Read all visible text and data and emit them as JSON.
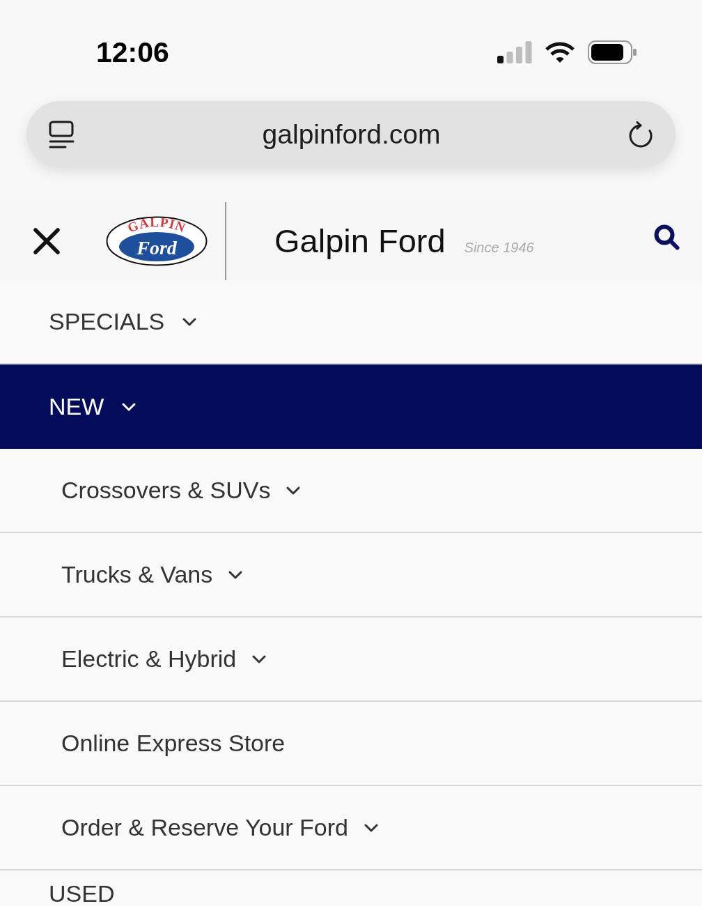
{
  "status_bar": {
    "time": "12:06"
  },
  "browser": {
    "url": "galpinford.com"
  },
  "header": {
    "logo": {
      "arc_text": "GALPIN",
      "script_text": "Ford"
    },
    "title": "Galpin Ford",
    "tagline": "Since 1946"
  },
  "menu": [
    {
      "label": "SPECIALS",
      "kind": "dropdown",
      "expanded": false
    },
    {
      "label": "NEW",
      "kind": "dropdown",
      "expanded": true,
      "children": [
        {
          "label": "Crossovers & SUVs",
          "kind": "dropdown"
        },
        {
          "label": "Trucks & Vans",
          "kind": "dropdown"
        },
        {
          "label": "Electric & Hybrid",
          "kind": "dropdown"
        },
        {
          "label": "Online Express Store",
          "kind": "link"
        },
        {
          "label": "Order & Reserve Your Ford",
          "kind": "dropdown"
        }
      ]
    },
    {
      "label": "USED",
      "kind": "link",
      "expanded": false
    }
  ]
}
